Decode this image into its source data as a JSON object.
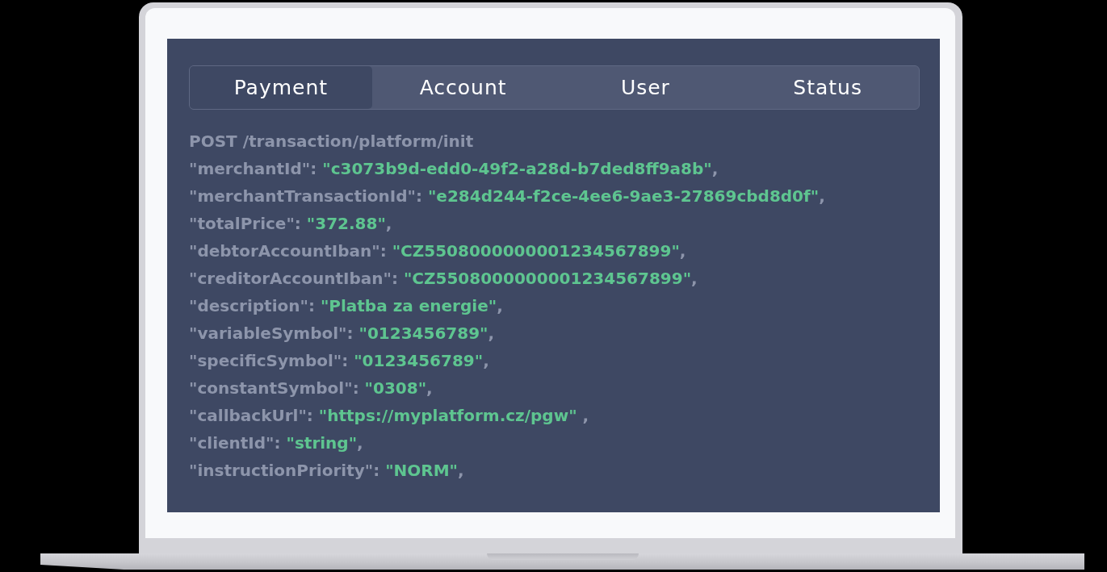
{
  "tabs": [
    {
      "label": "Payment",
      "selected": true
    },
    {
      "label": "Account",
      "selected": false
    },
    {
      "label": "User",
      "selected": false
    },
    {
      "label": "Status",
      "selected": false
    }
  ],
  "request": {
    "endpoint": "POST /transaction/platform/init",
    "fields": [
      {
        "key": "\"merchantId\":",
        "value": "\"c3073b9d-edd0-49f2-a28d-b7ded8ff9a8b\"",
        "end": ","
      },
      {
        "key": "\"merchantTransactionId\":",
        "value": "\"e284d244-f2ce-4ee6-9ae3-27869cbd8d0f\"",
        "end": ","
      },
      {
        "key": "\"totalPrice\":",
        "value": "\"372.88\"",
        "end": ","
      },
      {
        "key": "\"debtorAccountIban\":",
        "value": "\"CZ5508000000001234567899\"",
        "end": ","
      },
      {
        "key": "\"creditorAccountIban\":",
        "value": "\"CZ5508000000001234567899\"",
        "end": ","
      },
      {
        "key": "\"description\":",
        "value": "\"Platba za energie\"",
        "end": ","
      },
      {
        "key": "\"variableSymbol\":",
        "value": "\"0123456789\"",
        "end": ","
      },
      {
        "key": "\"specificSymbol\":",
        "value": "\"0123456789\"",
        "end": ","
      },
      {
        "key": "\"constantSymbol\":",
        "value": "\"0308\"",
        "end": ","
      },
      {
        "key": "\"callbackUrl\":",
        "value": "\"https://myplatform.cz/pgw\"",
        "end": " ,"
      },
      {
        "key": "\"clientId\":",
        "value": "\"string\"",
        "end": ","
      },
      {
        "key": "\"instructionPriority\":",
        "value": "\"NORM\"",
        "end": ","
      }
    ]
  }
}
